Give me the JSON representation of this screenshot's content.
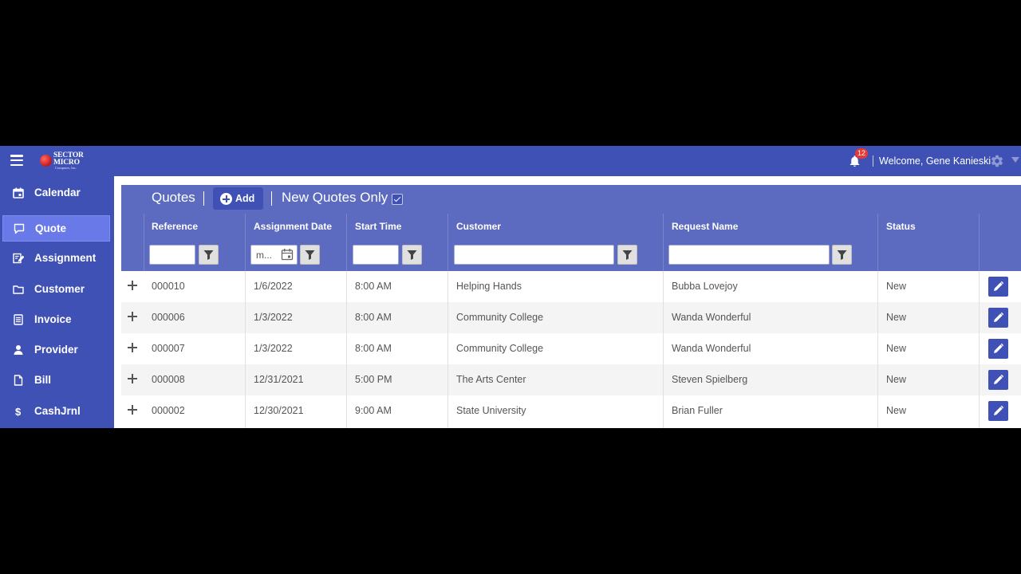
{
  "header": {
    "logo_text_line1": "SECTOR",
    "logo_text_line2": "MICRO",
    "logo_subtext": "Computer, Inc.",
    "notification_count": "12",
    "welcome_text": "Welcome, Gene Kanieski",
    "bell_icon": "bell-icon",
    "settings_icon": "gear-icon"
  },
  "sidebar": {
    "items": [
      {
        "label": "Calendar",
        "icon": "calendar-icon",
        "active": false
      },
      {
        "label": "Quote",
        "icon": "chat-bubble-icon",
        "active": true
      },
      {
        "label": "Assignment",
        "icon": "edit-doc-icon",
        "active": false
      },
      {
        "label": "Customer",
        "icon": "folder-icon",
        "active": false
      },
      {
        "label": "Invoice",
        "icon": "invoice-icon",
        "active": false
      },
      {
        "label": "Provider",
        "icon": "person-icon",
        "active": false
      },
      {
        "label": "Bill",
        "icon": "document-icon",
        "active": false
      },
      {
        "label": "CashJrnl",
        "icon": "dollar-icon",
        "active": false
      }
    ]
  },
  "main": {
    "title": "Quotes",
    "add_label": "Add",
    "filter_toggle_label": "New Quotes Only",
    "filter_toggle_checked": true,
    "columns": [
      "Reference",
      "Assignment Date",
      "Start Time",
      "Customer",
      "Request Name",
      "Status"
    ],
    "filters": {
      "reference": "",
      "assignment_date": "m...",
      "start_time": "",
      "customer": "",
      "request_name": ""
    },
    "rows": [
      {
        "reference": "000010",
        "assignment_date": "1/6/2022",
        "start_time": "8:00 AM",
        "customer": "Helping Hands",
        "request_name": "Bubba Lovejoy",
        "status": "New"
      },
      {
        "reference": "000006",
        "assignment_date": "1/3/2022",
        "start_time": "8:00 AM",
        "customer": "Community College",
        "request_name": "Wanda Wonderful",
        "status": "New"
      },
      {
        "reference": "000007",
        "assignment_date": "1/3/2022",
        "start_time": "8:00 AM",
        "customer": "Community College",
        "request_name": "Wanda Wonderful",
        "status": "New"
      },
      {
        "reference": "000008",
        "assignment_date": "12/31/2021",
        "start_time": "5:00 PM",
        "customer": "The Arts Center",
        "request_name": "Steven Spielberg",
        "status": "New"
      },
      {
        "reference": "000002",
        "assignment_date": "12/30/2021",
        "start_time": "9:00 AM",
        "customer": "State University",
        "request_name": "Brian Fuller",
        "status": "New"
      }
    ]
  },
  "colors": {
    "primary": "#3f51b5",
    "header_row": "#5c6bc0",
    "active_nav": "#6979e8",
    "badge": "#e53935"
  }
}
